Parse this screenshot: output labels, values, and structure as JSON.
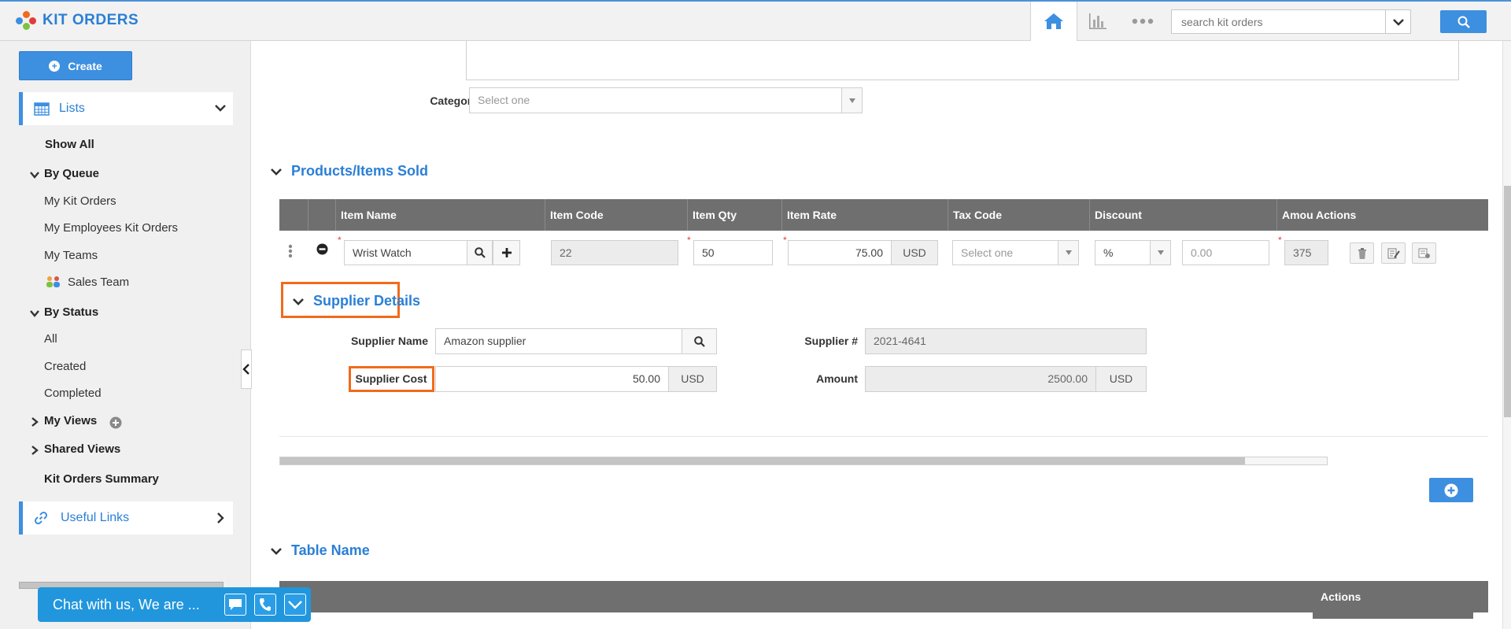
{
  "app": {
    "title": "KIT ORDERS",
    "accent_color": "#3d8fe0",
    "highlight_color": "#f26a1b"
  },
  "topbar": {
    "search_placeholder": "search kit orders",
    "icons": [
      "home-icon",
      "bar-chart-icon",
      "more-icon",
      "chevron-down-icon",
      "search-icon"
    ]
  },
  "sidebar": {
    "create_label": "Create",
    "lists_label": "Lists",
    "show_all": "Show All",
    "by_queue": "By Queue",
    "my_kit_orders": "My Kit Orders",
    "my_employees_kit_orders": "My Employees Kit Orders",
    "my_teams": "My Teams",
    "sales_team": "Sales Team",
    "by_status": "By Status",
    "all": "All",
    "created": "Created",
    "completed": "Completed",
    "my_views": "My Views",
    "shared_views": "Shared Views",
    "kit_orders_summary": "Kit Orders Summary",
    "useful_links": "Useful Links"
  },
  "form": {
    "category_label": "Category",
    "category_value": "Select one"
  },
  "products": {
    "section_title": "Products/Items Sold",
    "columns": [
      "Item Name",
      "Item Code",
      "Item Qty",
      "Item Rate",
      "Tax Code",
      "Discount",
      "Amou",
      "Actions"
    ],
    "row": {
      "item_name": "Wrist Watch",
      "item_code": "22",
      "item_qty": "50",
      "item_rate": "75.00",
      "rate_currency": "USD",
      "tax_code": "Select one",
      "discount_type": "%",
      "discount_value": "0.00",
      "amount": "375"
    }
  },
  "supplier": {
    "section_title": "Supplier Details",
    "name_label": "Supplier Name",
    "name_value": "Amazon  supplier",
    "number_label": "Supplier #",
    "number_value": "2021-4641",
    "cost_label": "Supplier Cost",
    "cost_value": "50.00",
    "cost_currency": "USD",
    "amount_label": "Amount",
    "amount_value": "2500.00",
    "amount_currency": "USD"
  },
  "table_name": {
    "section_title": "Table Name",
    "actions_label": "Actions"
  },
  "chat": {
    "text": "Chat with us, We are ..."
  }
}
